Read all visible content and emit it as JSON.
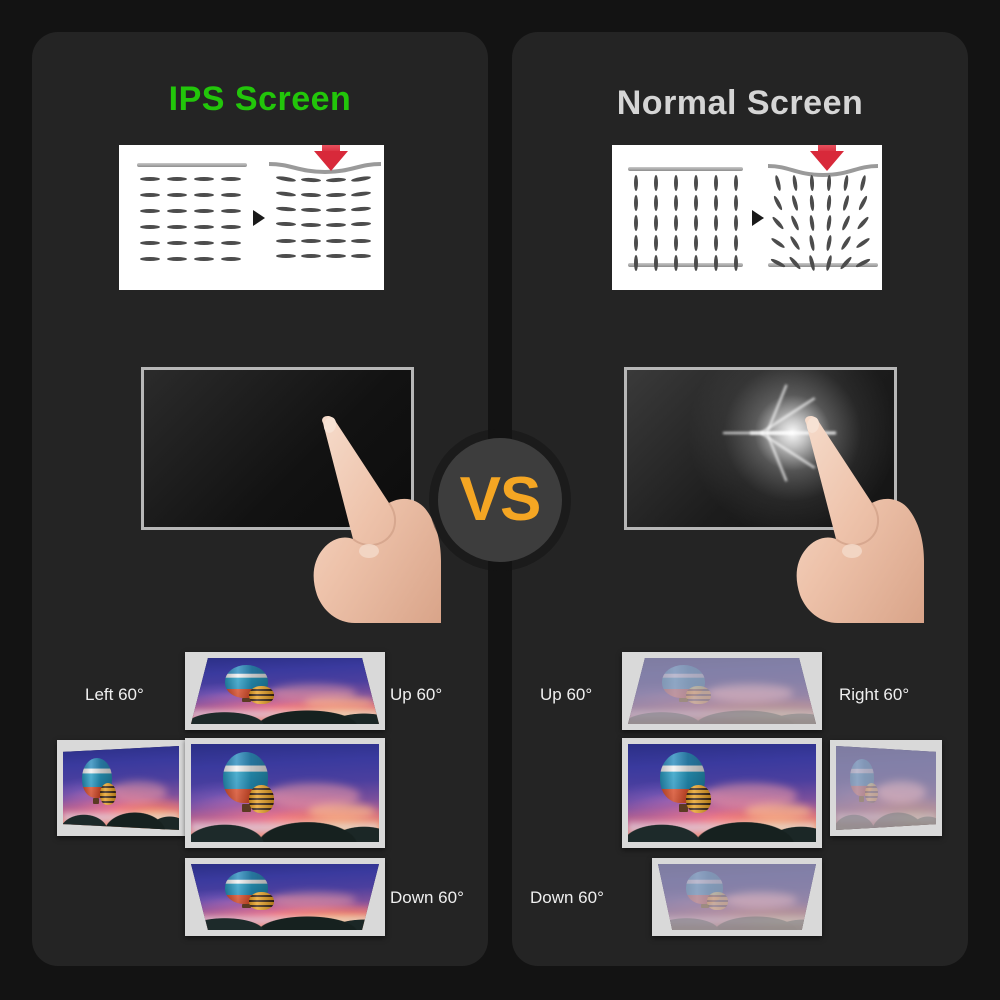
{
  "background_color": "#131313",
  "panel_color": "#242424",
  "panels": [
    {
      "id": "ips",
      "title": "IPS Screen",
      "title_color": "#22c60a",
      "lc_diagram": {
        "name": "liquid-crystal-pressure-diagram",
        "molecule_orientation": "horizontal",
        "states": [
          "at rest",
          "under pressure"
        ],
        "arrow": "red-down-arrow"
      },
      "touch_demo": {
        "name": "finger-press-demo",
        "screen_state": "no glow",
        "screen_color": "#121212"
      },
      "viewing_angles": {
        "up": "Up 60°",
        "down": "Down 60°",
        "left": "Left 60°",
        "center": "center view",
        "image_quality": "vivid"
      }
    },
    {
      "id": "normal",
      "title": "Normal Screen",
      "title_color": "#d5d5d5",
      "lc_diagram": {
        "name": "liquid-crystal-pressure-diagram",
        "molecule_orientation": "vertical",
        "states": [
          "at rest",
          "under pressure"
        ],
        "arrow": "red-down-arrow"
      },
      "touch_demo": {
        "name": "finger-press-demo",
        "screen_state": "bright white glow at touch point",
        "screen_color": "#1c1c1c"
      },
      "viewing_angles": {
        "up": "Up 60°",
        "down": "Down 60°",
        "right": "Right 60°",
        "center": "center view",
        "image_quality": "washed out"
      }
    }
  ],
  "vs_badge": {
    "label": "VS",
    "text_color": "#f5a623",
    "circle_color": "#3d3d3d"
  },
  "photo": {
    "subject": "hot air balloons at sunset",
    "alt": "two hot air balloons over mountains at dusk"
  }
}
